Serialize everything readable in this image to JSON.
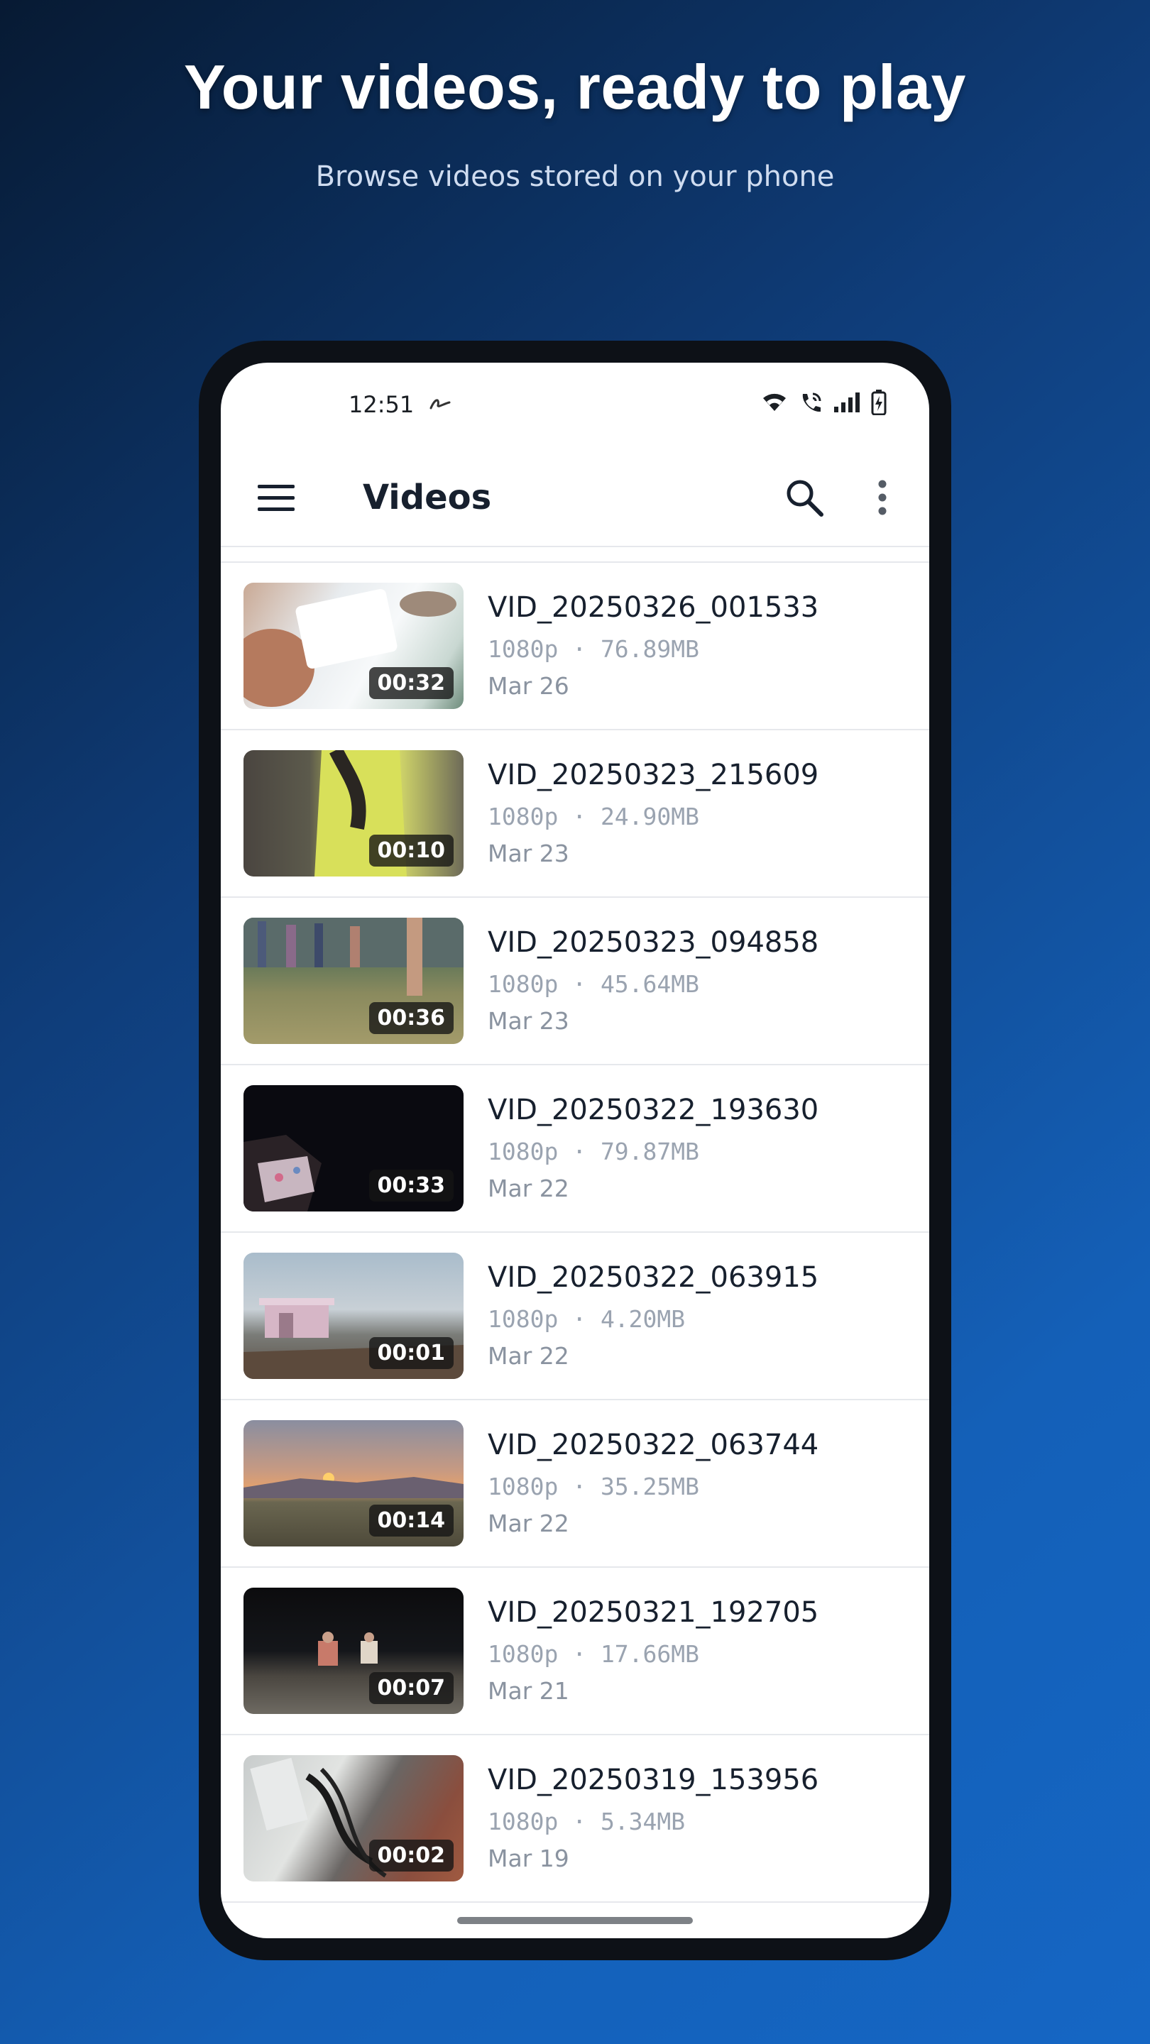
{
  "promo": {
    "headline": "Your videos, ready to play",
    "subheadline": "Browse videos stored on your phone"
  },
  "status_bar": {
    "time": "12:51",
    "icons": [
      "notification-icon",
      "wifi-icon",
      "wifi-call-icon",
      "signal-icon",
      "battery-charging-icon"
    ]
  },
  "app_bar": {
    "title": "Videos",
    "icons": [
      "menu-icon",
      "search-icon",
      "more-vert-icon"
    ]
  },
  "videos": [
    {
      "name": "VID_20250326_001533",
      "resolution": "1080p",
      "size": "76.89MB",
      "meta": "1080p · 76.89MB",
      "date": "Mar 26",
      "duration": "00:32"
    },
    {
      "name": "VID_20250323_215609",
      "resolution": "1080p",
      "size": "24.90MB",
      "meta": "1080p · 24.90MB",
      "date": "Mar 23",
      "duration": "00:10"
    },
    {
      "name": "VID_20250323_094858",
      "resolution": "1080p",
      "size": "45.64MB",
      "meta": "1080p · 45.64MB",
      "date": "Mar 23",
      "duration": "00:36"
    },
    {
      "name": "VID_20250322_193630",
      "resolution": "1080p",
      "size": "79.87MB",
      "meta": "1080p · 79.87MB",
      "date": "Mar 22",
      "duration": "00:33"
    },
    {
      "name": "VID_20250322_063915",
      "resolution": "1080p",
      "size": "4.20MB",
      "meta": "1080p · 4.20MB",
      "date": "Mar 22",
      "duration": "00:01"
    },
    {
      "name": "VID_20250322_063744",
      "resolution": "1080p",
      "size": "35.25MB",
      "meta": "1080p · 35.25MB",
      "date": "Mar 22",
      "duration": "00:14"
    },
    {
      "name": "VID_20250321_192705",
      "resolution": "1080p",
      "size": "17.66MB",
      "meta": "1080p · 17.66MB",
      "date": "Mar 21",
      "duration": "00:07"
    },
    {
      "name": "VID_20250319_153956",
      "resolution": "1080p",
      "size": "5.34MB",
      "meta": "1080p · 5.34MB",
      "date": "Mar 19",
      "duration": "00:02"
    }
  ],
  "colors": {
    "background_start": "#071a33",
    "background_end": "#1566c4",
    "phone_frame": "#0d1117",
    "title_text": "#17202e",
    "meta_text": "#9aa3b0"
  }
}
